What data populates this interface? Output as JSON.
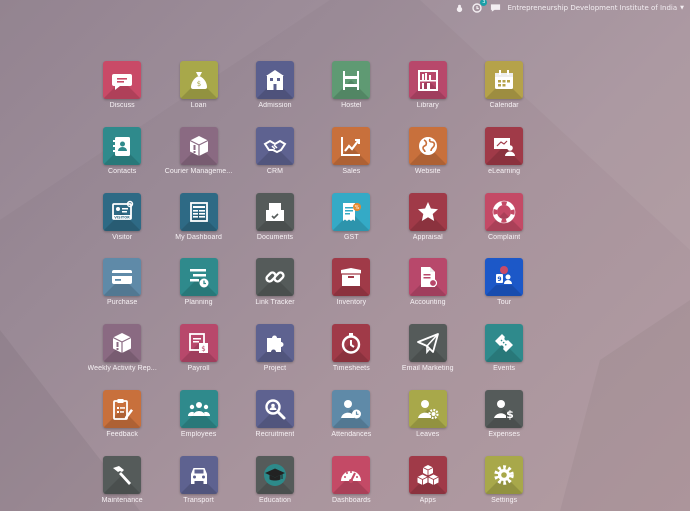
{
  "topbar": {
    "company": "Entrepreneurship Development Institute of India",
    "notification_count": "3"
  },
  "apps": [
    {
      "label": "Discuss",
      "color": "#c94a67",
      "icon": "chat-icon"
    },
    {
      "label": "Loan",
      "color": "#a8a84a",
      "icon": "money-bag-icon"
    },
    {
      "label": "Admission",
      "color": "#5a5f8e",
      "icon": "building-icon"
    },
    {
      "label": "Hostel",
      "color": "#5f9a73",
      "icon": "bunk-bed-icon"
    },
    {
      "label": "Library",
      "color": "#b8486b",
      "icon": "bookshelf-icon"
    },
    {
      "label": "Calendar",
      "color": "#b5a24a",
      "icon": "calendar-icon"
    },
    {
      "label": "Contacts",
      "color": "#2f8a8c",
      "icon": "address-book-icon"
    },
    {
      "label": "Courier Manageme...",
      "color": "#8a6a82",
      "icon": "package-alert-icon"
    },
    {
      "label": "CRM",
      "color": "#5e6290",
      "icon": "handshake-icon"
    },
    {
      "label": "Sales",
      "color": "#c8703c",
      "icon": "chart-line-icon"
    },
    {
      "label": "Website",
      "color": "#c8703c",
      "icon": "globe-icon"
    },
    {
      "label": "eLearning",
      "color": "#a03a48",
      "icon": "presentation-icon"
    },
    {
      "label": "Visitor",
      "color": "#2e6a85",
      "icon": "visitor-badge-icon"
    },
    {
      "label": "My Dashboard",
      "color": "#2e6a85",
      "icon": "dashboard-list-icon"
    },
    {
      "label": "Documents",
      "color": "#555b5a",
      "icon": "document-tray-icon"
    },
    {
      "label": "GST",
      "color": "#34aac6",
      "icon": "invoice-icon"
    },
    {
      "label": "Appraisal",
      "color": "#a03a48",
      "icon": "star-icon"
    },
    {
      "label": "Complaint",
      "color": "#c44a66",
      "icon": "lifebuoy-icon"
    },
    {
      "label": "Purchase",
      "color": "#5f8aa8",
      "icon": "credit-card-icon"
    },
    {
      "label": "Planning",
      "color": "#2f8a8c",
      "icon": "planning-icon"
    },
    {
      "label": "Link Tracker",
      "color": "#555b5a",
      "icon": "link-icon"
    },
    {
      "label": "Inventory",
      "color": "#a03a48",
      "icon": "box-icon"
    },
    {
      "label": "Accounting",
      "color": "#b8486b",
      "icon": "accounting-doc-icon"
    },
    {
      "label": "Tour",
      "color": "#1c58c8",
      "icon": "tour-icon"
    },
    {
      "label": "Weekly Activity Rep...",
      "color": "#8a6a82",
      "icon": "package-alert-icon"
    },
    {
      "label": "Payroll",
      "color": "#b8486b",
      "icon": "payroll-icon"
    },
    {
      "label": "Project",
      "color": "#5e6290",
      "icon": "puzzle-icon"
    },
    {
      "label": "Timesheets",
      "color": "#a03a48",
      "icon": "stopwatch-icon"
    },
    {
      "label": "Email Marketing",
      "color": "#555b5a",
      "icon": "paper-plane-icon"
    },
    {
      "label": "Events",
      "color": "#2f8a8c",
      "icon": "ticket-icon"
    },
    {
      "label": "Feedback",
      "color": "#c8703c",
      "icon": "clipboard-edit-icon"
    },
    {
      "label": "Employees",
      "color": "#2f8a8c",
      "icon": "people-icon"
    },
    {
      "label": "Recruitment",
      "color": "#5e6290",
      "icon": "magnifier-icon"
    },
    {
      "label": "Attendances",
      "color": "#5f8aa8",
      "icon": "user-clock-icon"
    },
    {
      "label": "Leaves",
      "color": "#a8a84a",
      "icon": "user-gear-icon"
    },
    {
      "label": "Expenses",
      "color": "#555b5a",
      "icon": "user-dollar-icon"
    },
    {
      "label": "Maintenance",
      "color": "#555b5a",
      "icon": "hammer-icon"
    },
    {
      "label": "Transport",
      "color": "#5e6290",
      "icon": "car-icon"
    },
    {
      "label": "Education",
      "color": "#555b5a",
      "icon": "graduation-cap-icon"
    },
    {
      "label": "Dashboards",
      "color": "#c44a66",
      "icon": "gauge-icon"
    },
    {
      "label": "Apps",
      "color": "#a03a48",
      "icon": "cubes-icon"
    },
    {
      "label": "Settings",
      "color": "#a8a84a",
      "icon": "gear-icon"
    }
  ]
}
